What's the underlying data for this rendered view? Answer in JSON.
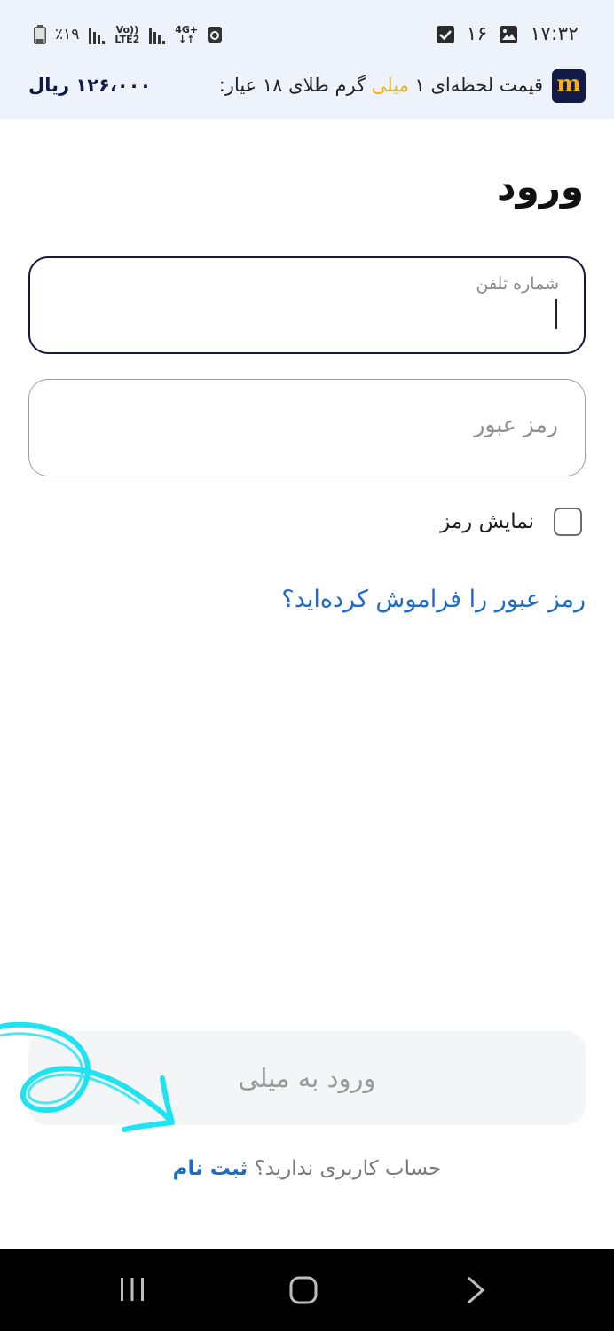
{
  "status_bar": {
    "time": "۱۷:۳۲",
    "notification_count": "۱۶",
    "battery": "٪۱۹",
    "network_volte": "Vo))",
    "network_lte": "LTE2",
    "network_gen": "4G+"
  },
  "price_bar": {
    "logo_letter": "m",
    "label_before": "قیمت لحظه‌ای ۱",
    "label_accent": "میلی",
    "label_after": "گرم طلای ۱۸ عیار:",
    "value": "۱۲۶،۰۰۰ ریال"
  },
  "page_title": "ورود",
  "phone_field": {
    "label": "شماره تلفن",
    "value": ""
  },
  "password_field": {
    "placeholder": "رمز عبور",
    "value": ""
  },
  "show_password": {
    "label": "نمایش رمز",
    "checked": false
  },
  "forgot_password_link": "رمز عبور را فراموش کرده‌اید؟",
  "login_button": "ورود به میلی",
  "signup": {
    "prompt": "حساب کاربری ندارید؟",
    "link": "ثبت نام"
  },
  "colors": {
    "accent_gold": "#f2b01e",
    "brand_navy": "#101a45",
    "link_blue": "#1f6cc6",
    "annotation_cyan": "#1fe3f0"
  },
  "icons": {
    "status_left": [
      "battery-icon",
      "signal-icon",
      "signal-icon"
    ],
    "status_right": [
      "checkbox-notification-icon",
      "gallery-notification-icon"
    ],
    "nav": [
      "recents-icon",
      "home-icon",
      "back-icon"
    ]
  }
}
